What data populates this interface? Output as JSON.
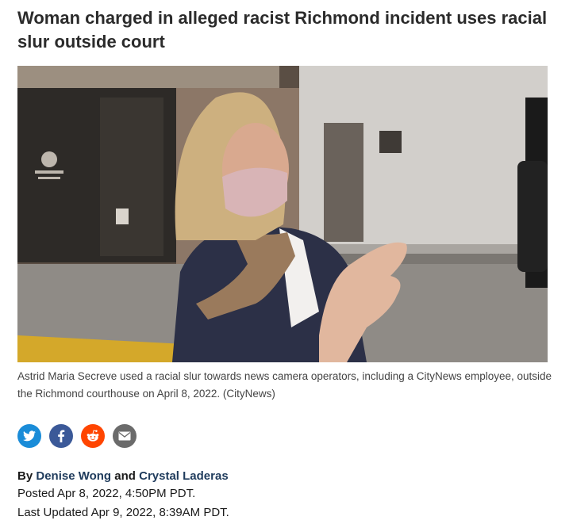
{
  "article": {
    "headline": "Woman charged in alleged racist Richmond incident uses racial slur outside court",
    "caption": "Astrid Maria Secreve used a racial slur towards news camera operators, including a CityNews employee, outside the Richmond courthouse on April 8, 2022. (CityNews)",
    "byline": {
      "prefix": "By",
      "author1": "Denise Wong",
      "joiner": "and",
      "author2": "Crystal Laderas"
    },
    "posted": "Posted Apr 8, 2022, 4:50PM PDT.",
    "updated": "Last Updated Apr 9, 2022, 8:39AM PDT."
  },
  "share": [
    {
      "name": "twitter-share",
      "icon": "twitter-icon",
      "color": "#1a8cd8"
    },
    {
      "name": "facebook-share",
      "icon": "facebook-icon",
      "color": "#3b5998"
    },
    {
      "name": "reddit-share",
      "icon": "reddit-icon",
      "color": "#ff4500"
    },
    {
      "name": "email-share",
      "icon": "email-icon",
      "color": "#6b6b6b"
    }
  ]
}
